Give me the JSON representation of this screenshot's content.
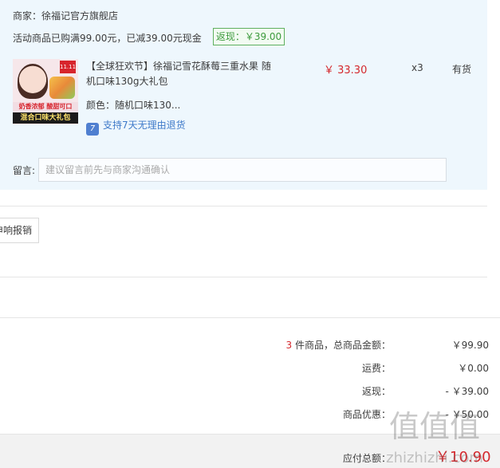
{
  "store": {
    "shop_label": "商家：徐福记官方旗舰店",
    "promo_text": "活动商品已购满99.00元，已减39.00元现金",
    "rebate_badge": "返现：￥39.00"
  },
  "product": {
    "thumb_badge": "11.11",
    "thumb_line1": "奶香浓郁 酸甜可口",
    "thumb_line2": "混合口味大礼包",
    "title": "【全球狂欢节】徐福记雪花酥莓三重水果 随机口味130g大礼包",
    "price": "￥ 33.30",
    "quantity": "x3",
    "stock": "有货",
    "color": "颜色：随机口味130...",
    "return_icon": "7",
    "return_policy": "支持7天无理由退货"
  },
  "message": {
    "label": "留言:",
    "placeholder": "建议留言前先与商家沟通确认"
  },
  "invoice": {
    "button": "申响报销"
  },
  "summary": {
    "item_count": "3",
    "items_label": " 件商品，总商品金额：",
    "items_total": "￥99.90",
    "shipping_label": "运费：",
    "shipping_value": "￥0.00",
    "cashback_label": "返现：",
    "cashback_value": "- ￥39.00",
    "discount_label": "商品优惠：",
    "discount_value": "- ￥50.00",
    "payable_label": "应付总额：",
    "payable_value": "￥10.90"
  },
  "watermark": {
    "text": "值值值",
    "url": "zhizhizhi.com"
  },
  "colors": {
    "accent_red": "#d4282d",
    "link_blue": "#3f7ac9",
    "rebate_green": "#3c9a3c",
    "panel_bg": "#eef7fd"
  }
}
